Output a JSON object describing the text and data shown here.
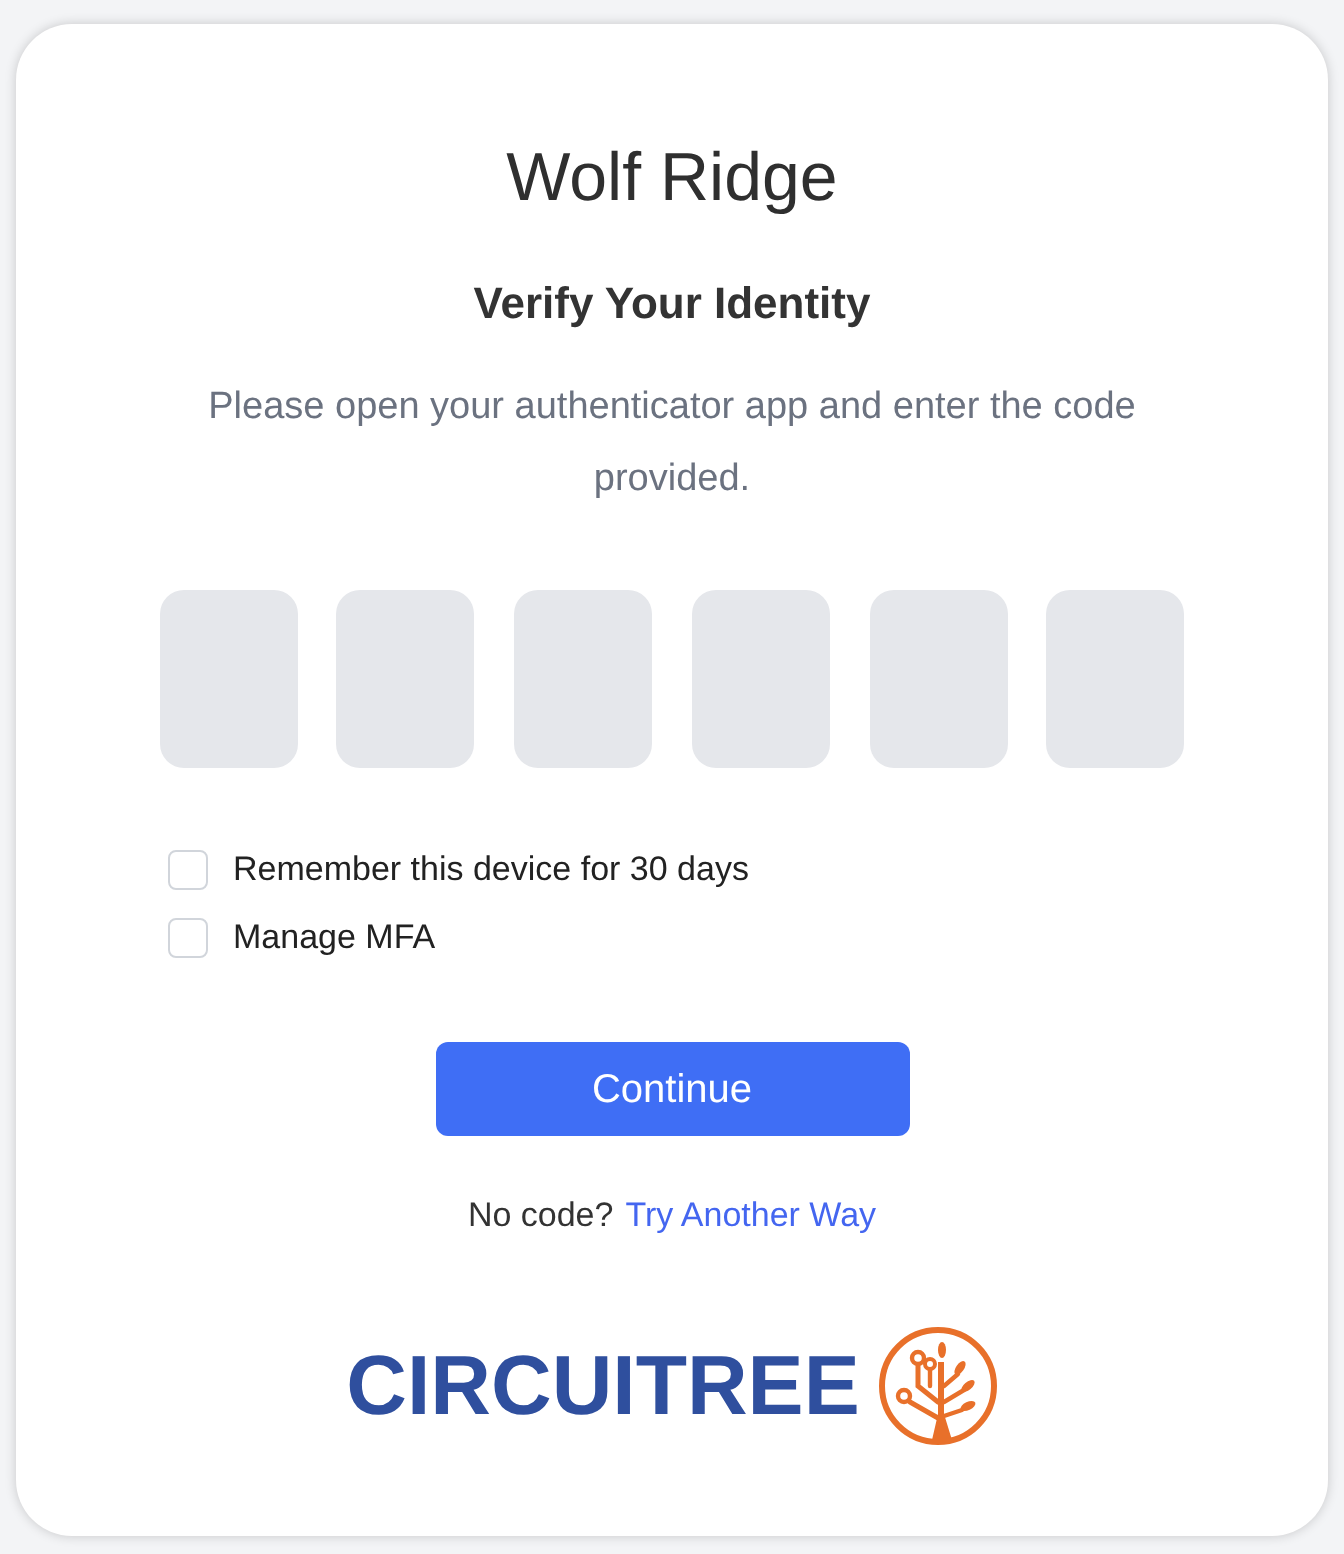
{
  "title": "Wolf Ridge",
  "heading": "Verify Your Identity",
  "description": "Please open your authenticator app and enter the code provided.",
  "code_boxes": [
    {
      "focused": false
    },
    {
      "focused": false
    },
    {
      "focused": false
    },
    {
      "focused": false
    },
    {
      "focused": false
    },
    {
      "focused": false
    }
  ],
  "options": [
    {
      "label": "Remember this device for 30 days",
      "checked": false
    },
    {
      "label": "Manage MFA",
      "checked": false
    }
  ],
  "submit_button": "Continue",
  "footer": {
    "prompt": "No code?",
    "link": "Try Another Way"
  },
  "logo": {
    "wordmark": "CIRCUITREE"
  }
}
